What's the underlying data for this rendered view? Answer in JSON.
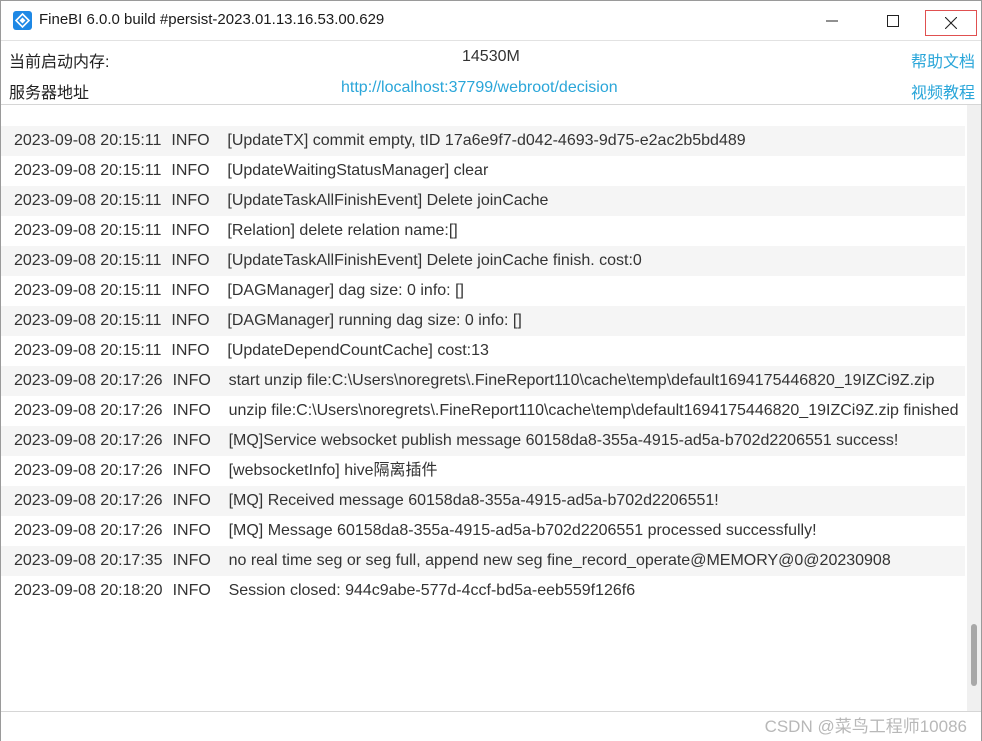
{
  "window": {
    "title": "FineBI 6.0.0 build #persist-2023.01.13.16.53.00.629"
  },
  "info": {
    "memory_label": "当前启动内存:",
    "memory_value": "14530M",
    "help_link": "帮助文档",
    "address_label": "服务器地址",
    "address_value": "http://localhost:37799/webroot/decision",
    "video_link": "视频教程"
  },
  "logs": [
    {
      "ts": "2023-09-08 20:15:11",
      "level": "INFO",
      "msg": "[UpdateTX] commit empty, tID 17a6e9f7-d042-4693-9d75-e2ac2b5bd489"
    },
    {
      "ts": "2023-09-08 20:15:11",
      "level": "INFO",
      "msg": "[UpdateWaitingStatusManager] clear"
    },
    {
      "ts": "2023-09-08 20:15:11",
      "level": "INFO",
      "msg": "[UpdateTaskAllFinishEvent] Delete joinCache"
    },
    {
      "ts": "2023-09-08 20:15:11",
      "level": "INFO",
      "msg": "[Relation] delete relation name:[]"
    },
    {
      "ts": "2023-09-08 20:15:11",
      "level": "INFO",
      "msg": "[UpdateTaskAllFinishEvent] Delete joinCache finish. cost:0"
    },
    {
      "ts": "2023-09-08 20:15:11",
      "level": "INFO",
      "msg": "[DAGManager] dag size: 0 info: []"
    },
    {
      "ts": "2023-09-08 20:15:11",
      "level": "INFO",
      "msg": "[DAGManager] running dag size: 0 info: []"
    },
    {
      "ts": "2023-09-08 20:15:11",
      "level": "INFO",
      "msg": "[UpdateDependCountCache] cost:13"
    },
    {
      "ts": "2023-09-08 20:17:26",
      "level": "INFO",
      "msg": "start unzip file:C:\\Users\\noregrets\\.FineReport110\\cache\\temp\\default1694175446820_19IZCi9Z.zip"
    },
    {
      "ts": "2023-09-08 20:17:26",
      "level": "INFO",
      "msg": "unzip file:C:\\Users\\noregrets\\.FineReport110\\cache\\temp\\default1694175446820_19IZCi9Z.zip finished"
    },
    {
      "ts": "2023-09-08 20:17:26",
      "level": "INFO",
      "msg": "[MQ]Service websocket publish message 60158da8-355a-4915-ad5a-b702d2206551 success!"
    },
    {
      "ts": "2023-09-08 20:17:26",
      "level": "INFO",
      "msg": "[websocketInfo] hive隔离插件"
    },
    {
      "ts": "2023-09-08 20:17:26",
      "level": "INFO",
      "msg": "[MQ] Received message 60158da8-355a-4915-ad5a-b702d2206551!"
    },
    {
      "ts": "2023-09-08 20:17:26",
      "level": "INFO",
      "msg": "[MQ] Message 60158da8-355a-4915-ad5a-b702d2206551 processed successfully!"
    },
    {
      "ts": "2023-09-08 20:17:35",
      "level": "INFO",
      "msg": "no real time seg or seg full, append new seg fine_record_operate@MEMORY@0@20230908"
    },
    {
      "ts": "2023-09-08 20:18:20",
      "level": "INFO",
      "msg": "Session closed: 944c9abe-577d-4ccf-bd5a-eeb559f126f6"
    }
  ],
  "scroll_position": 0.96,
  "watermark": "CSDN @菜鸟工程师10086",
  "icons": {
    "app": "finebi-logo-icon",
    "minimize": "minimize-icon",
    "maximize": "maximize-icon",
    "close": "close-icon"
  },
  "colors": {
    "link": "#2aa6d9",
    "close_border": "#e05050",
    "row_alt": "#f5f5f5",
    "logo": "#1e88e5"
  }
}
